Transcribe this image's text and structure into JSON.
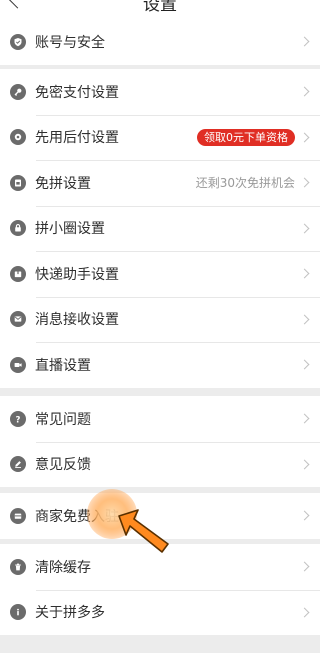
{
  "header": {
    "title": "设置"
  },
  "groups": [
    {
      "items": [
        {
          "label": "账号与安全",
          "icon": "shield-icon"
        }
      ]
    },
    {
      "items": [
        {
          "label": "免密支付设置",
          "icon": "key-icon"
        },
        {
          "label": "先用后付设置",
          "icon": "gear-icon",
          "badge": "领取0元下单资格"
        },
        {
          "label": "免拼设置",
          "icon": "document-icon",
          "hint": "还剩30次免拼机会"
        },
        {
          "label": "拼小圈设置",
          "icon": "lock-icon"
        },
        {
          "label": "快递助手设置",
          "icon": "package-icon"
        },
        {
          "label": "消息接收设置",
          "icon": "message-icon"
        },
        {
          "label": "直播设置",
          "icon": "video-icon"
        }
      ]
    },
    {
      "items": [
        {
          "label": "常见问题",
          "icon": "question-icon"
        },
        {
          "label": "意见反馈",
          "icon": "edit-icon"
        }
      ]
    },
    {
      "items": [
        {
          "label": "商家免费入驻",
          "icon": "store-icon"
        }
      ]
    },
    {
      "items": [
        {
          "label": "清除缓存",
          "icon": "trash-icon"
        },
        {
          "label": "关于拼多多",
          "icon": "info-icon"
        }
      ]
    }
  ],
  "colors": {
    "accent": "#e02e24",
    "icon": "#6b6b6b",
    "background": "#ececec"
  }
}
